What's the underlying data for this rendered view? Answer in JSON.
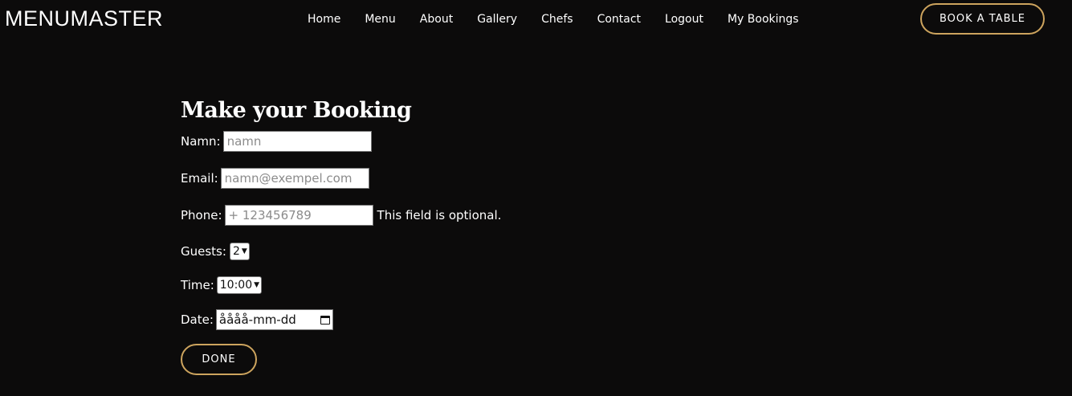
{
  "brand": {
    "logo_text": "MENUMASTER"
  },
  "nav": {
    "items": [
      "Home",
      "Menu",
      "About",
      "Gallery",
      "Chefs",
      "Contact",
      "Logout",
      "My Bookings"
    ]
  },
  "header": {
    "book_button_label": "BOOK A TABLE"
  },
  "form": {
    "title": "Make your Booking",
    "name_label": "Namn:",
    "name_placeholder": "namn",
    "email_label": "Email:",
    "email_placeholder": "namn@exempel.com",
    "phone_label": "Phone:",
    "phone_placeholder": "+ 123456789",
    "phone_note": "This field is optional.",
    "guests_label": "Guests:",
    "guests_value": "2",
    "time_label": "Time:",
    "time_value": "10:00",
    "date_label": "Date:",
    "date_value": "åååå-mm-dd",
    "done_label": "DONE"
  },
  "colors": {
    "background": "#0c0b0b",
    "accent": "#cda45e",
    "text": "#ffffff"
  }
}
